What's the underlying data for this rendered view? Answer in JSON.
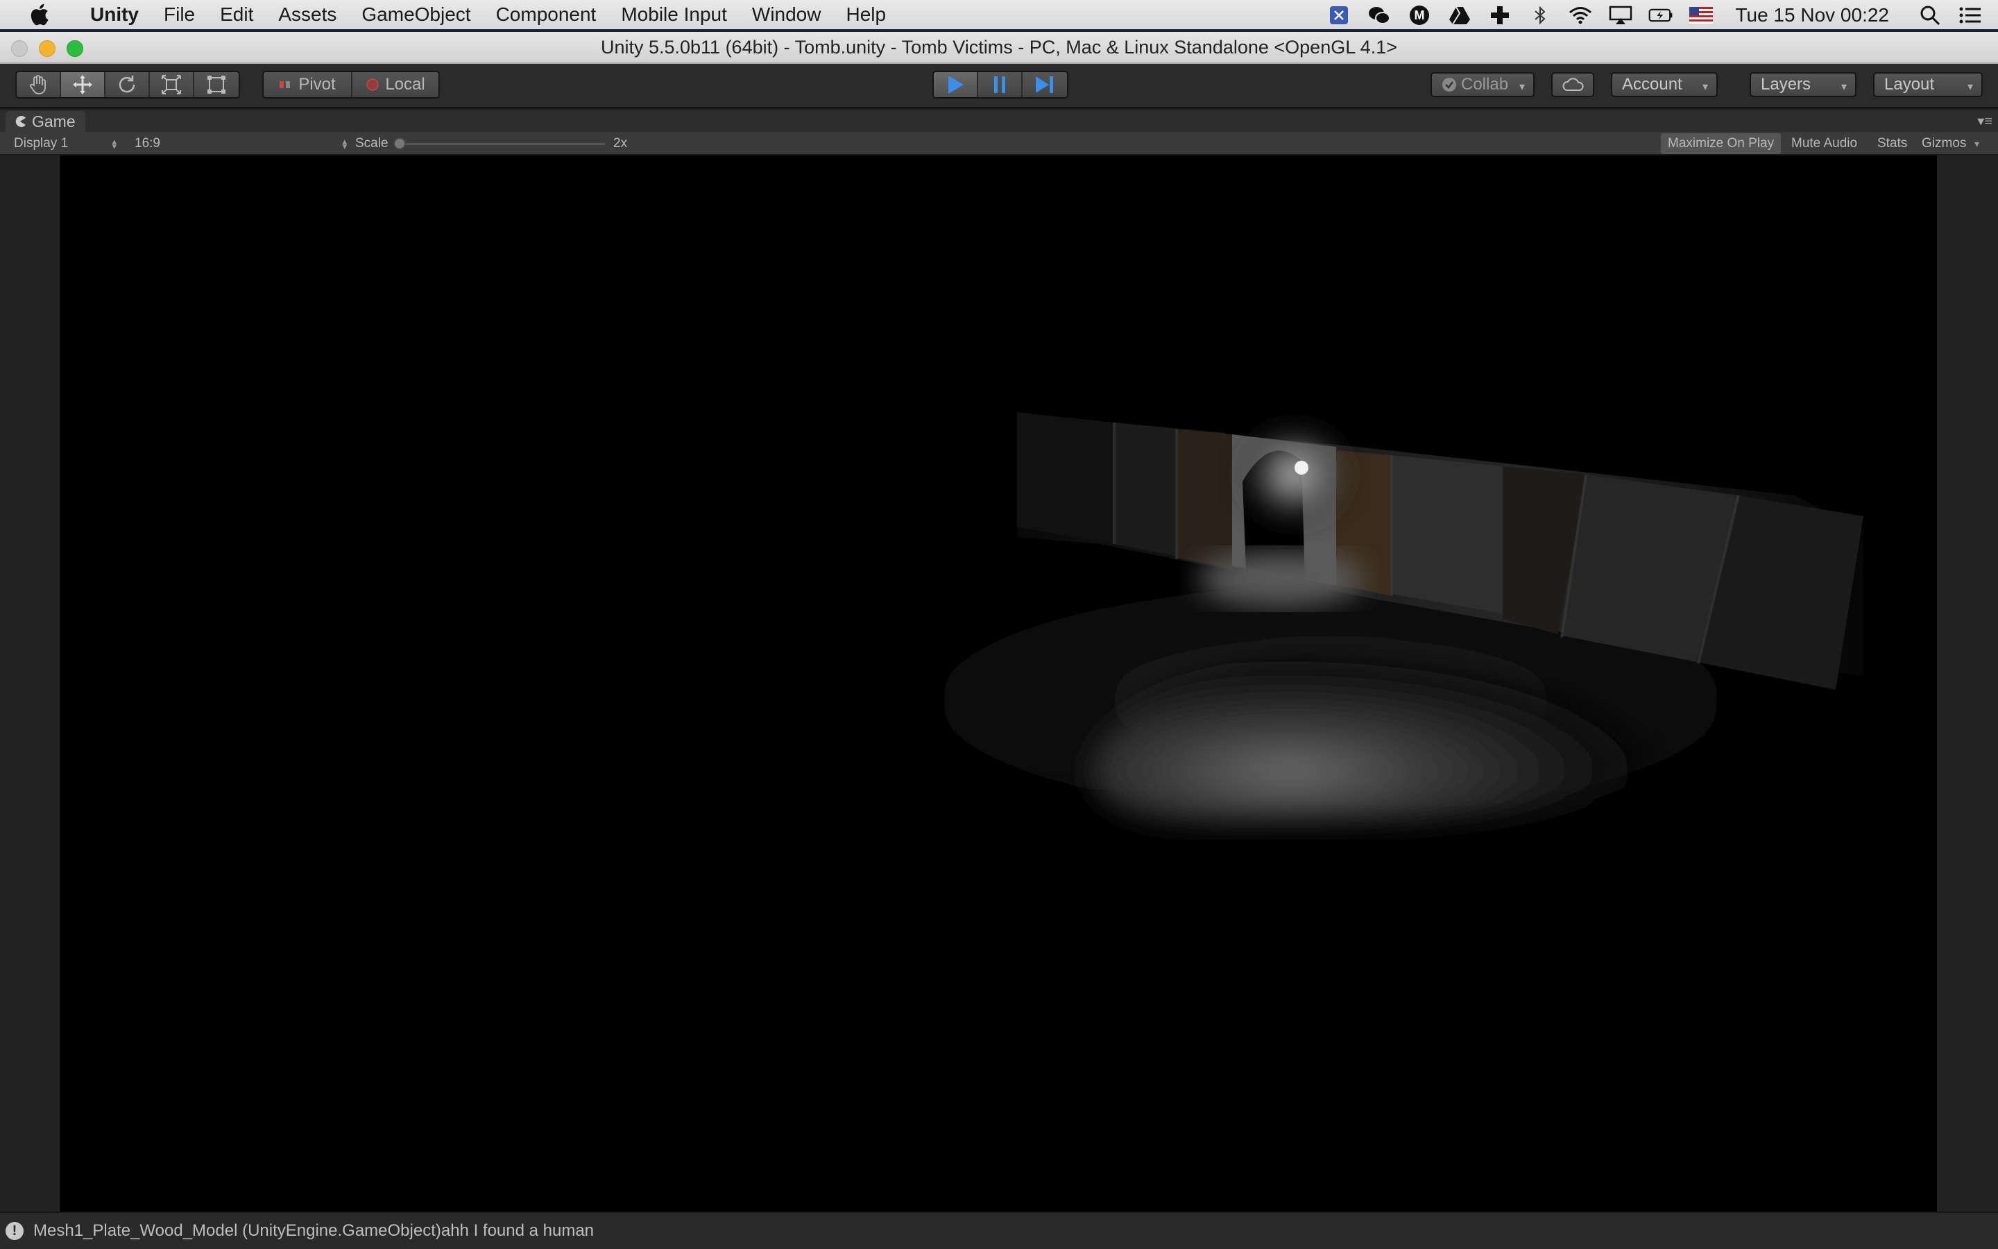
{
  "menubar": {
    "app_name": "Unity",
    "items": [
      "File",
      "Edit",
      "Assets",
      "GameObject",
      "Component",
      "Mobile Input",
      "Window",
      "Help"
    ],
    "clock": "Tue 15 Nov  00:22",
    "status_icons": [
      "bluetooth-network-icon",
      "wechat-icon",
      "m-app-icon",
      "google-drive-icon",
      "plus-cross-icon",
      "bluetooth-icon",
      "wifi-icon",
      "airplay-icon",
      "battery-charging-icon",
      "us-flag-icon"
    ]
  },
  "window": {
    "title": "Unity 5.5.0b11 (64bit) - Tomb.unity - Tomb Victims - PC, Mac & Linux Standalone <OpenGL 4.1>"
  },
  "toolbar": {
    "pivot_label": "Pivot",
    "local_label": "Local",
    "collab_label": "Collab",
    "account_label": "Account",
    "layers_label": "Layers",
    "layout_label": "Layout"
  },
  "game_view": {
    "tab_label": "Game",
    "display": "Display 1",
    "aspect": "16:9",
    "scale_label": "Scale",
    "scale_value": "2x",
    "scale_fraction": 0.0,
    "maximize_on_play": "Maximize On Play",
    "mute_audio": "Mute Audio",
    "stats": "Stats",
    "gizmos": "Gizmos"
  },
  "console": {
    "last_message": "Mesh1_Plate_Wood_Model (UnityEngine.GameObject)ahh I found a human"
  },
  "colors": {
    "play_blue": "#3d8ee8",
    "menubar_bg": "#e3e3e3",
    "editor_dark": "#2b2b2b"
  }
}
